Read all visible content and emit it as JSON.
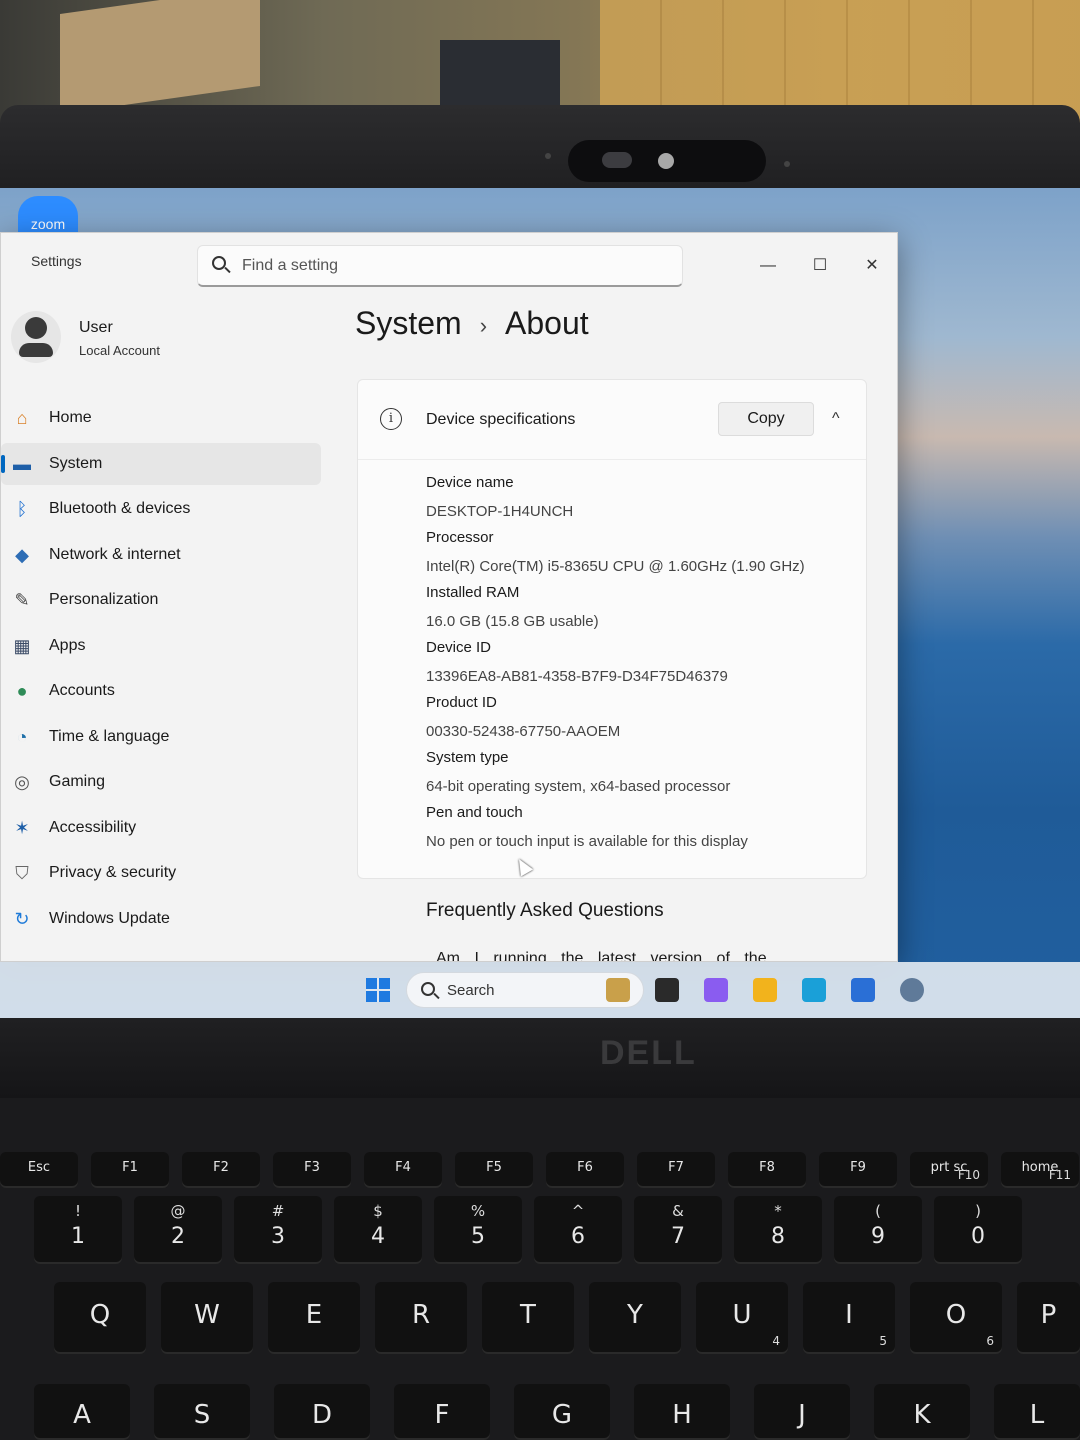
{
  "window": {
    "app_title": "Settings",
    "search_placeholder": "Find a setting",
    "minimize": "—",
    "maximize": "☐",
    "close": "✕"
  },
  "overlay": {
    "zoom_badge": "zoom"
  },
  "profile": {
    "name": "User",
    "account_type": "Local Account"
  },
  "sidebar": {
    "items": [
      {
        "label": "Home",
        "icon": "home-icon",
        "glyph": "⌂",
        "color": "#d9822b",
        "active": false
      },
      {
        "label": "System",
        "icon": "monitor-icon",
        "glyph": "▬",
        "color": "#1e5fa8",
        "active": true
      },
      {
        "label": "Bluetooth & devices",
        "icon": "bluetooth-icon",
        "glyph": "ᛒ",
        "color": "#1e6fd0",
        "active": false
      },
      {
        "label": "Network & internet",
        "icon": "wifi-icon",
        "glyph": "◆",
        "color": "#2d6db5",
        "active": false
      },
      {
        "label": "Personalization",
        "icon": "brush-icon",
        "glyph": "✎",
        "color": "#444444",
        "active": false
      },
      {
        "label": "Apps",
        "icon": "apps-icon",
        "glyph": "▦",
        "color": "#3a4a66",
        "active": false
      },
      {
        "label": "Accounts",
        "icon": "person-icon",
        "glyph": "●",
        "color": "#2e8b57",
        "active": false
      },
      {
        "label": "Time & language",
        "icon": "clock-globe-icon",
        "glyph": "◔",
        "color": "#1e6fa8",
        "active": false
      },
      {
        "label": "Gaming",
        "icon": "gamepad-icon",
        "glyph": "◎",
        "color": "#555555",
        "active": false
      },
      {
        "label": "Accessibility",
        "icon": "accessibility-icon",
        "glyph": "✶",
        "color": "#1e5fa8",
        "active": false
      },
      {
        "label": "Privacy & security",
        "icon": "shield-icon",
        "glyph": "⛉",
        "color": "#666666",
        "active": false
      },
      {
        "label": "Windows Update",
        "icon": "update-icon",
        "glyph": "↻",
        "color": "#1e7ad8",
        "active": false
      }
    ]
  },
  "content": {
    "breadcrumb_parent": "System",
    "breadcrumb_sep": "›",
    "breadcrumb_current": "About",
    "card": {
      "title": "Device specifications",
      "copy_label": "Copy",
      "chevron": "^",
      "info_glyph": "i",
      "specs": [
        {
          "key": "Device name",
          "value": "DESKTOP-1H4UNCH"
        },
        {
          "key": "Processor",
          "value": "Intel(R) Core(TM) i5-8365U CPU @ 1.60GHz (1.90 GHz)"
        },
        {
          "key": "Installed RAM",
          "value": "16.0 GB (15.8 GB usable)"
        },
        {
          "key": "Device ID",
          "value": "13396EA8-AB81-4358-B7F9-D34F75D46379"
        },
        {
          "key": "Product ID",
          "value": "00330-52438-67750-AAOEM"
        },
        {
          "key": "System type",
          "value": "64-bit operating system, x64-based processor"
        },
        {
          "key": "Pen and touch",
          "value": "No pen or touch input is available for this display"
        }
      ]
    },
    "faq_title": "Frequently Asked Questions",
    "faq_question": "Am I running the latest version of the"
  },
  "taskbar": {
    "search_label": "Search",
    "apps": [
      {
        "name": "widgets-icon",
        "color": "#c9a04a"
      },
      {
        "name": "task-view-icon",
        "color": "#2a2a2a"
      },
      {
        "name": "copilot-icon",
        "color": "#8a5cf0"
      },
      {
        "name": "file-explorer-icon",
        "color": "#f2b31c"
      },
      {
        "name": "edge-icon",
        "color": "#1aa0d8"
      },
      {
        "name": "store-icon",
        "color": "#2a6fd6"
      },
      {
        "name": "settings-icon",
        "color": "#5f7a99"
      }
    ]
  },
  "hardware": {
    "brand": "DELL",
    "keys": {
      "fn_row": [
        {
          "main": "Esc",
          "sub": ""
        },
        {
          "main": "F1",
          "sub": ""
        },
        {
          "main": "F2",
          "sub": ""
        },
        {
          "main": "F3",
          "sub": ""
        },
        {
          "main": "F4",
          "sub": ""
        },
        {
          "main": "F5",
          "sub": ""
        },
        {
          "main": "F6",
          "sub": ""
        },
        {
          "main": "F7",
          "sub": ""
        },
        {
          "main": "F8",
          "sub": ""
        },
        {
          "main": "F9",
          "sub": ""
        },
        {
          "main": "prt sc",
          "sub": "F10"
        },
        {
          "main": "home",
          "sub": "F11"
        }
      ],
      "num_row": [
        {
          "main": "1",
          "sub": "!"
        },
        {
          "main": "2",
          "sub": "@"
        },
        {
          "main": "3",
          "sub": "#"
        },
        {
          "main": "4",
          "sub": "$"
        },
        {
          "main": "5",
          "sub": "%"
        },
        {
          "main": "6",
          "sub": "^"
        },
        {
          "main": "7",
          "sub": "&"
        },
        {
          "main": "8",
          "sub": "*"
        },
        {
          "main": "9",
          "sub": "("
        },
        {
          "main": "0",
          "sub": ")"
        }
      ],
      "q_row": [
        {
          "main": "Q",
          "sub": ""
        },
        {
          "main": "W",
          "sub": ""
        },
        {
          "main": "E",
          "sub": ""
        },
        {
          "main": "R",
          "sub": ""
        },
        {
          "main": "T",
          "sub": ""
        },
        {
          "main": "Y",
          "sub": ""
        },
        {
          "main": "U",
          "sub": "4"
        },
        {
          "main": "I",
          "sub": "5"
        },
        {
          "main": "O",
          "sub": "6"
        },
        {
          "main": "P",
          "sub": ""
        }
      ],
      "a_row": [
        {
          "main": "A",
          "sub": ""
        },
        {
          "main": "S",
          "sub": ""
        },
        {
          "main": "D",
          "sub": ""
        },
        {
          "main": "F",
          "sub": ""
        },
        {
          "main": "G",
          "sub": ""
        },
        {
          "main": "H",
          "sub": ""
        },
        {
          "main": "J",
          "sub": ""
        },
        {
          "main": "K",
          "sub": ""
        },
        {
          "main": "L",
          "sub": ""
        }
      ]
    }
  }
}
